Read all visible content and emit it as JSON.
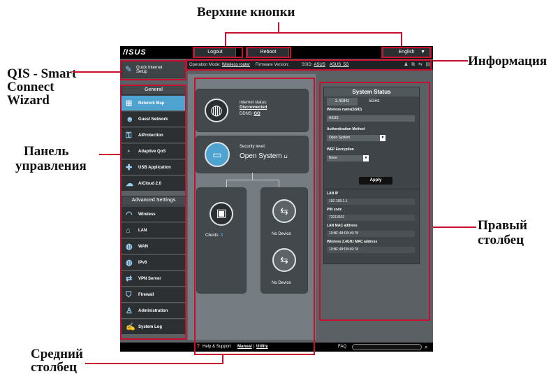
{
  "annotations": {
    "top_buttons": "Верхние кнопки",
    "info": "Информация",
    "qis_1": "QIS - Smart",
    "qis_2": "Connect",
    "qis_3": "Wizard",
    "nav_1": "Панель",
    "nav_2": "управления",
    "right_1": "Правый",
    "right_2": "столбец",
    "mid_1": "Средний",
    "mid_2": "столбец"
  },
  "header": {
    "logo": "/ISUS",
    "logout": "Logout",
    "reboot": "Reboot",
    "language": "English"
  },
  "info": {
    "mode_label": "Operation Mode:",
    "mode_value": "Wireless router",
    "fw_label": "Firmware Version:",
    "ssid_label": "SSID:",
    "ssid1": "ASUS",
    "ssid2": "ASUS_5G"
  },
  "qis": {
    "line1": "Quick Internet",
    "line2": "Setup"
  },
  "menu": {
    "general": "General",
    "items": [
      "Network Map",
      "Guest Network",
      "AiProtection",
      "Adaptive QoS",
      "USB Application",
      "AiCloud 2.0"
    ],
    "advanced": "Advanced Settings",
    "adv_items": [
      "Wireless",
      "LAN",
      "WAN",
      "IPv6",
      "VPN Server",
      "Firewall",
      "Administration",
      "System Log"
    ]
  },
  "middle": {
    "internet_status_label": "Internet status:",
    "internet_status_value": "Disconnected",
    "ddns_label": "DDNS:",
    "ddns_value": "GO",
    "security_label": "Security level:",
    "security_value": "Open System",
    "clients_label": "Clients:",
    "clients_count": "3",
    "usb1": "No Device",
    "usb2": "No Device"
  },
  "system_status": {
    "title": "System Status",
    "tab1": "2.4GHz",
    "tab2": "5GHz",
    "ssid_label": "Wireless name(SSID)",
    "ssid_value": "ASUS",
    "auth_label": "Authentication Method",
    "auth_value": "Open System",
    "wep_label": "WEP Encryption",
    "wep_value": "None",
    "apply": "Apply",
    "lan_ip_label": "LAN IP",
    "lan_ip_value": "192.168.1.1",
    "pin_label": "PIN code",
    "pin_value": "72013502",
    "lan_mac_label": "LAN MAC address",
    "lan_mac_value": "10:BF:48:D8:49:78",
    "wmac_label": "Wireless 2.4GHz MAC address",
    "wmac_value": "10:BF:48:D8:49:78"
  },
  "footer": {
    "help": "Help & Support",
    "manual": "Manual",
    "utility": "Utility",
    "faq": "FAQ"
  },
  "colors": {
    "accent": "#4fa3d1",
    "annotation_line": "#c8102e"
  }
}
